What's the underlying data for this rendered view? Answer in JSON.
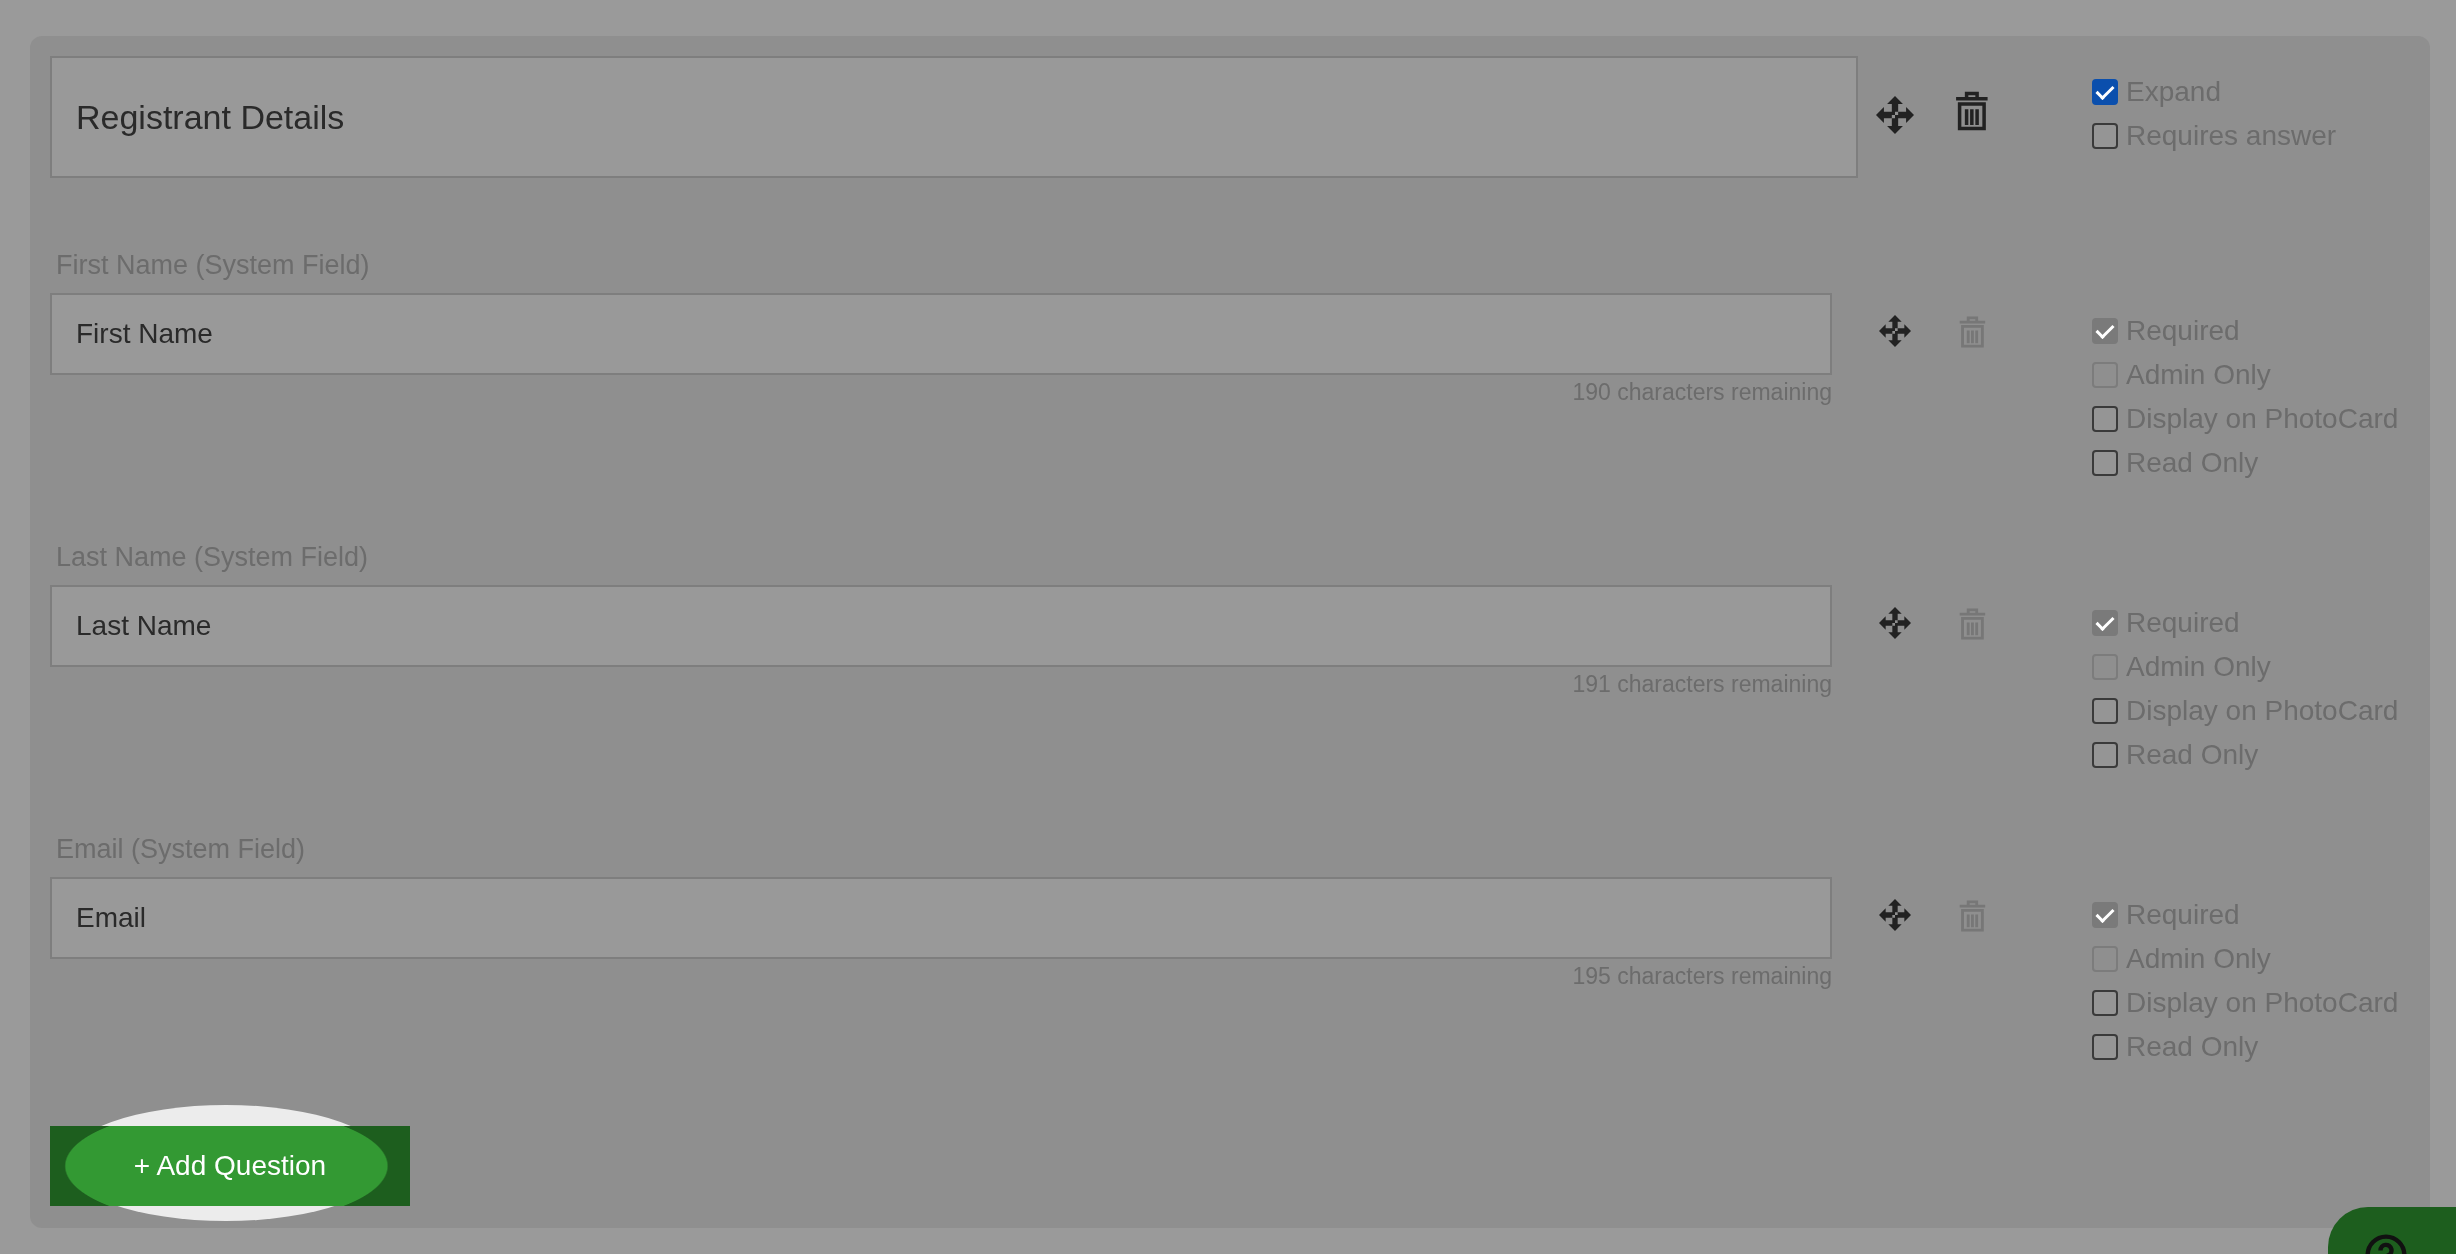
{
  "section": {
    "title": "Registrant Details",
    "delete_disabled": false,
    "options": [
      {
        "label": "Expand",
        "checked": true,
        "disabled": false
      },
      {
        "label": "Requires answer",
        "checked": false,
        "disabled": false
      }
    ]
  },
  "fields": [
    {
      "label": "First Name (System Field)",
      "value": "First Name",
      "counter": "190 characters remaining",
      "delete_disabled": true,
      "options": [
        {
          "label": "Required",
          "checked": true,
          "disabled": true
        },
        {
          "label": "Admin Only",
          "checked": false,
          "disabled": true
        },
        {
          "label": "Display on PhotoCard",
          "checked": false,
          "disabled": false
        },
        {
          "label": "Read Only",
          "checked": false,
          "disabled": false
        }
      ]
    },
    {
      "label": "Last Name (System Field)",
      "value": "Last Name",
      "counter": "191 characters remaining",
      "delete_disabled": true,
      "options": [
        {
          "label": "Required",
          "checked": true,
          "disabled": true
        },
        {
          "label": "Admin Only",
          "checked": false,
          "disabled": true
        },
        {
          "label": "Display on PhotoCard",
          "checked": false,
          "disabled": false
        },
        {
          "label": "Read Only",
          "checked": false,
          "disabled": false
        }
      ]
    },
    {
      "label": "Email (System Field)",
      "value": "Email",
      "counter": "195 characters remaining",
      "delete_disabled": true,
      "options": [
        {
          "label": "Required",
          "checked": true,
          "disabled": true
        },
        {
          "label": "Admin Only",
          "checked": false,
          "disabled": true
        },
        {
          "label": "Display on PhotoCard",
          "checked": false,
          "disabled": false
        },
        {
          "label": "Read Only",
          "checked": false,
          "disabled": false
        }
      ]
    }
  ],
  "add_button": {
    "label": "+ Add Question",
    "highlighted": true
  }
}
